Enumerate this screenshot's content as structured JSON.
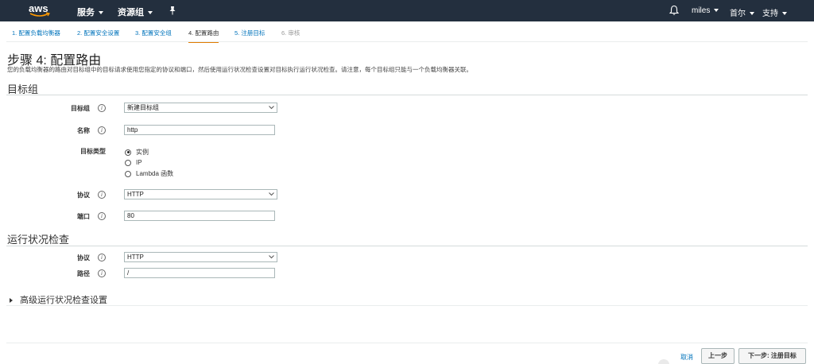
{
  "nav": {
    "logo_text": "aws",
    "services_label": "服务",
    "resource_groups_label": "资源组",
    "user_label": "miles",
    "region_label": "首尔",
    "support_label": "支持"
  },
  "wizard_tabs": [
    {
      "label": "1. 配置负载均衡器",
      "state": "link"
    },
    {
      "label": "2. 配置安全设置",
      "state": "link"
    },
    {
      "label": "3. 配置安全组",
      "state": "link"
    },
    {
      "label": "4. 配置路由",
      "state": "active"
    },
    {
      "label": "5. 注册目标",
      "state": "link"
    },
    {
      "label": "6. 审核",
      "state": "disabled"
    }
  ],
  "page": {
    "title": "步骤 4: 配置路由",
    "description": "您的负载均衡器的路由对目标组中的目标请求使用您指定的协议和端口，然后使用运行状况检查设置对目标执行运行状况检查。请注意，每个目标组只能与一个负载均衡器关联。"
  },
  "target_group": {
    "heading": "目标组",
    "target_group_label": "目标组",
    "target_group_value": "新建目标组",
    "name_label": "名称",
    "name_value": "http",
    "target_type_label": "目标类型",
    "target_type_options": [
      {
        "label": "实例",
        "selected": true
      },
      {
        "label": "IP",
        "selected": false
      },
      {
        "label": "Lambda 函数",
        "selected": false
      }
    ],
    "protocol_label": "协议",
    "protocol_value": "HTTP",
    "port_label": "端口",
    "port_value": "80"
  },
  "health_check": {
    "heading": "运行状况检查",
    "protocol_label": "协议",
    "protocol_value": "HTTP",
    "path_label": "路径",
    "path_value": "/",
    "advanced_label": "高级运行状况检查设置"
  },
  "footer": {
    "cancel_label": "取消",
    "previous_label": "上一步",
    "next_label": "下一步: 注册目标"
  },
  "icons": {
    "info": "info-icon",
    "bell": "bell-icon",
    "pin": "pin-icon"
  },
  "colors": {
    "nav_bg": "#232f3e",
    "link": "#0073bb",
    "active_tab_underline": "#e07b00"
  }
}
